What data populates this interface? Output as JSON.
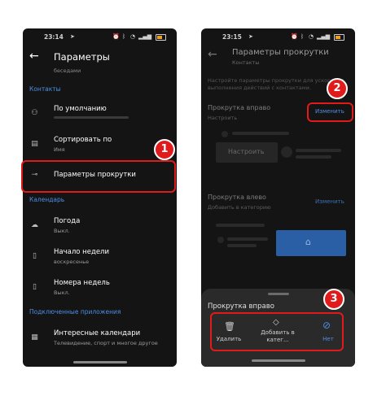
{
  "screen1": {
    "status": {
      "time": "23:14"
    },
    "header": {
      "title": "Параметры"
    },
    "top_clip": "беседами",
    "section_contacts": "Контакты",
    "items": [
      {
        "title": "По умолчанию",
        "sub": ""
      },
      {
        "title": "Сортировать по",
        "sub": "Имя"
      },
      {
        "title": "Параметры прокрутки",
        "sub": ""
      }
    ],
    "section_calendar": "Календарь",
    "calendar_items": [
      {
        "title": "Погода",
        "sub": "Выкл."
      },
      {
        "title": "Начало недели",
        "sub": "воскресенье"
      },
      {
        "title": "Номера недель",
        "sub": "Выкл."
      }
    ],
    "section_apps": "Подключенные приложения",
    "apps_items": [
      {
        "title": "Интересные календари",
        "sub": "Телевидение, спорт и многое другое"
      }
    ]
  },
  "screen2": {
    "status": {
      "time": "23:15"
    },
    "header": {
      "title": "Параметры прокрутки",
      "subtitle": "Контакты"
    },
    "description": "Настройте параметры прокрутки для ускорения выполнения действий с контактами.",
    "swipe_right": {
      "title": "Прокрутка вправо",
      "sub": "Настроить",
      "action": "Изменить"
    },
    "preview_button": "Настроить",
    "swipe_left": {
      "title": "Прокрутка влево",
      "sub": "Добавить в категорию",
      "action": "Изменить"
    },
    "sheet": {
      "title": "Прокрутка вправо",
      "actions": [
        {
          "label": "Удалить"
        },
        {
          "label": "Добавить в катег..."
        },
        {
          "label": "Нет"
        }
      ]
    }
  },
  "badges": [
    "1",
    "2",
    "3"
  ],
  "colors": {
    "accent": "#4d8fe6",
    "highlight": "#e11b1b",
    "phone_bg": "#141414"
  }
}
